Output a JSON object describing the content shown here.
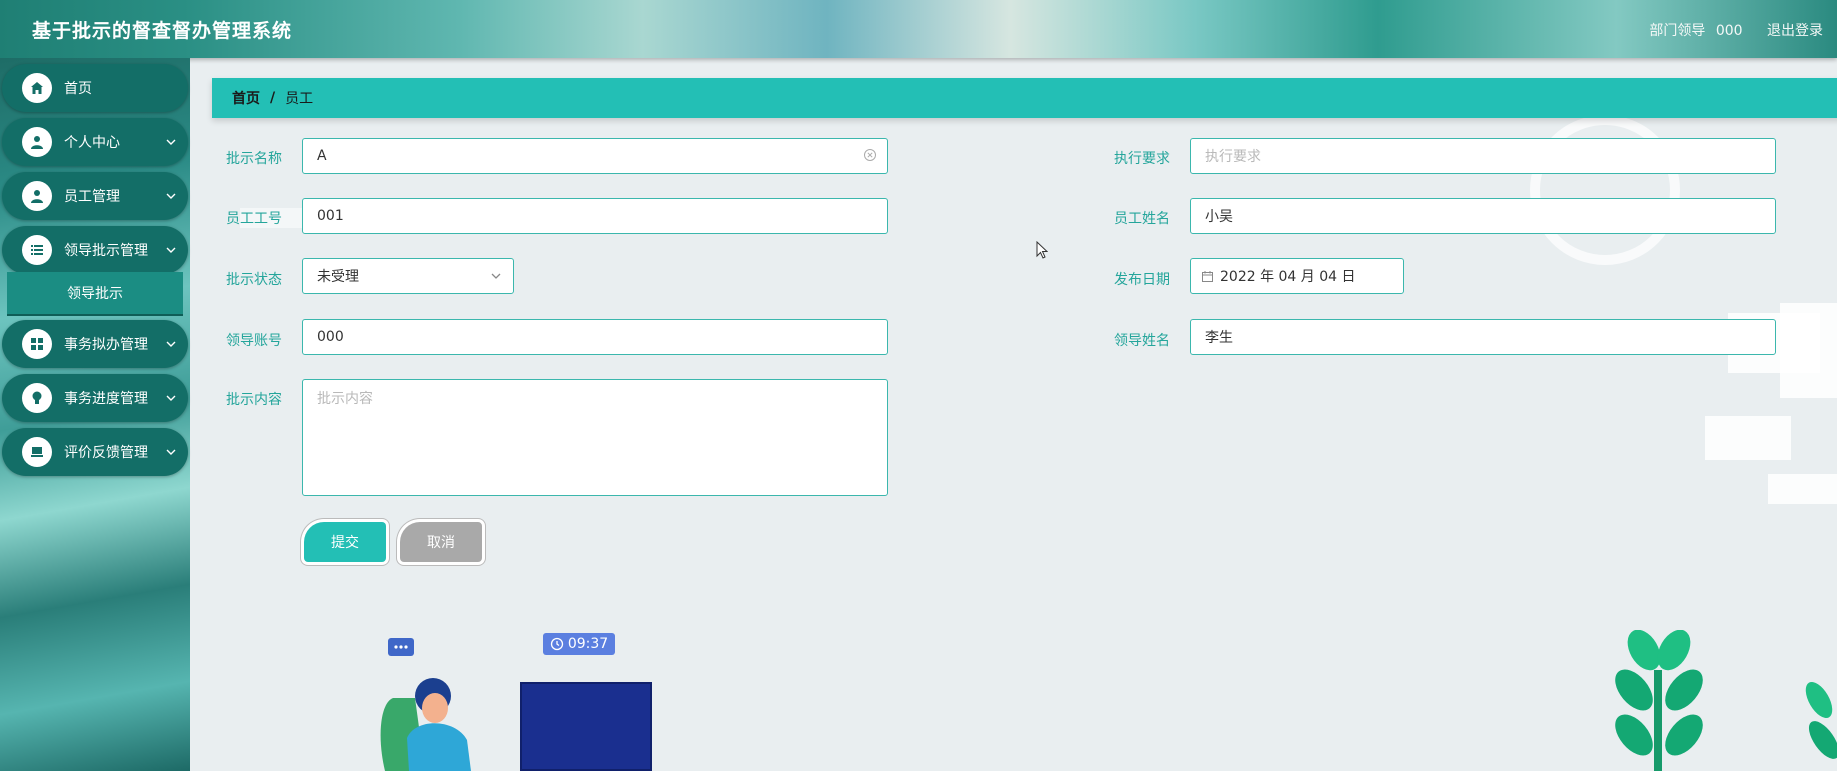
{
  "app": {
    "title": "基于批示的督查督办管理系统"
  },
  "header": {
    "role": "部门领导",
    "user": "000",
    "logout": "退出登录"
  },
  "sidebar": {
    "items": [
      {
        "label": "首页",
        "icon": "home-icon"
      },
      {
        "label": "个人中心",
        "icon": "person-icon"
      },
      {
        "label": "员工管理",
        "icon": "person-icon"
      },
      {
        "label": "领导批示管理",
        "icon": "list-icon"
      },
      {
        "label": "事务拟办管理",
        "icon": "grid-icon"
      },
      {
        "label": "事务进度管理",
        "icon": "bulb-icon"
      },
      {
        "label": "评价反馈管理",
        "icon": "monitor-icon"
      }
    ],
    "sub_item": "领导批示"
  },
  "breadcrumb": {
    "home": "首页",
    "sep": "/",
    "current": "员工"
  },
  "form": {
    "approval_name": {
      "label": "批示名称",
      "value": "A"
    },
    "requirement": {
      "label": "执行要求",
      "placeholder": "执行要求"
    },
    "employee_no": {
      "label": "员工工号",
      "value": "001"
    },
    "employee_name": {
      "label": "员工姓名",
      "value": "小吴"
    },
    "status": {
      "label": "批示状态",
      "value": "未受理"
    },
    "publish_date": {
      "label": "发布日期",
      "value": "2022 年 04 月 04 日"
    },
    "leader_account": {
      "label": "领导账号",
      "value": "000"
    },
    "leader_name": {
      "label": "领导姓名",
      "value": "李生"
    },
    "content": {
      "label": "批示内容",
      "placeholder": "批示内容"
    },
    "submit": "提交",
    "cancel": "取消"
  },
  "illustration": {
    "time": "09:37"
  },
  "colors": {
    "accent": "#23bfb5",
    "sidebar": "#136e67",
    "label": "#24a59b"
  }
}
